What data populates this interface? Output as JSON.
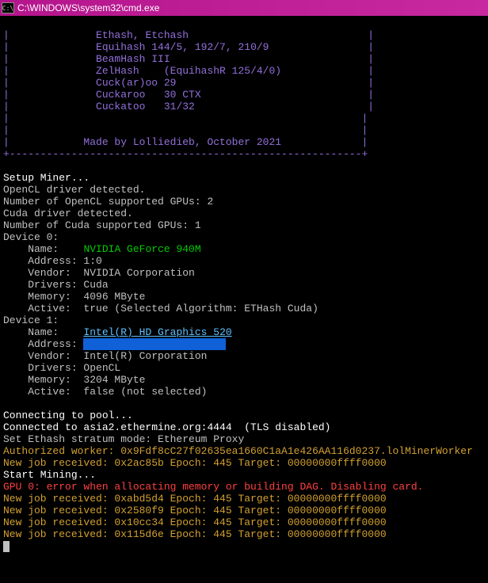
{
  "window": {
    "title": "C:\\WINDOWS\\system32\\cmd.exe"
  },
  "banner": {
    "lines": [
      "Ethash, Etchash",
      "Equihash 144/5, 192/7, 210/9",
      "BeamHash III",
      "ZelHash    (EquihashR 125/4/0)",
      "Cuck(ar)oo 29",
      "Cuckaroo   30 CTX",
      "Cuckatoo   31/32"
    ],
    "credit": "Made by Lolliedieb, October 2021",
    "divider": "+---------------------------------------------------------+"
  },
  "setup": {
    "header": "Setup Miner...",
    "opencl_detect": "OpenCL driver detected.",
    "opencl_count_label": "Number of OpenCL supported GPUs: ",
    "opencl_count": "2",
    "cuda_detect": "Cuda driver detected.",
    "cuda_count_label": "Number of Cuda supported GPUs: ",
    "cuda_count": "1"
  },
  "device0": {
    "header": "Device 0:",
    "name_label": "    Name:   ",
    "name_value": "NVIDIA GeForce 940M",
    "address": "    Address: 1:0",
    "vendor": "    Vendor:  NVIDIA Corporation",
    "drivers": "    Drivers: Cuda",
    "memory": "    Memory:  4096 MByte",
    "active": "    Active:  true (Selected Algorithm: ETHash Cuda)"
  },
  "device1": {
    "header": "Device 1:",
    "name_label": "    Name:   ",
    "name_value": "Intel(R) HD Graphics 520",
    "address_label": "    Address: ",
    "address_hl": "                       ",
    "vendor": "    Vendor:  Intel(R) Corporation",
    "drivers": "    Drivers: OpenCL",
    "memory": "    Memory:  3204 MByte",
    "active": "    Active:  false (not selected)"
  },
  "pool": {
    "connecting": "Connecting to pool...",
    "connected": "Connected to asia2.ethermine.org:4444  (TLS disabled)",
    "mode": "Set Ethash stratum mode: Ethereum Proxy",
    "auth": "Authorized worker: 0x9Fdf8cC27f02635ea1660C1aA1e426AA116d0237.lolMinerWorker",
    "job1": "New job received: 0x2ac85b Epoch: 445 Target: 00000000ffff0000",
    "start": "Start Mining...",
    "error": "GPU 0: error when allocating memory or building DAG. Disabling card.",
    "job2": "New job received: 0xabd5d4 Epoch: 445 Target: 00000000ffff0000",
    "job3": "New job received: 0x2580f9 Epoch: 445 Target: 00000000ffff0000",
    "job4": "New job received: 0x10cc34 Epoch: 445 Target: 00000000ffff0000",
    "job5": "New job received: 0x115d6e Epoch: 445 Target: 00000000ffff0000"
  }
}
